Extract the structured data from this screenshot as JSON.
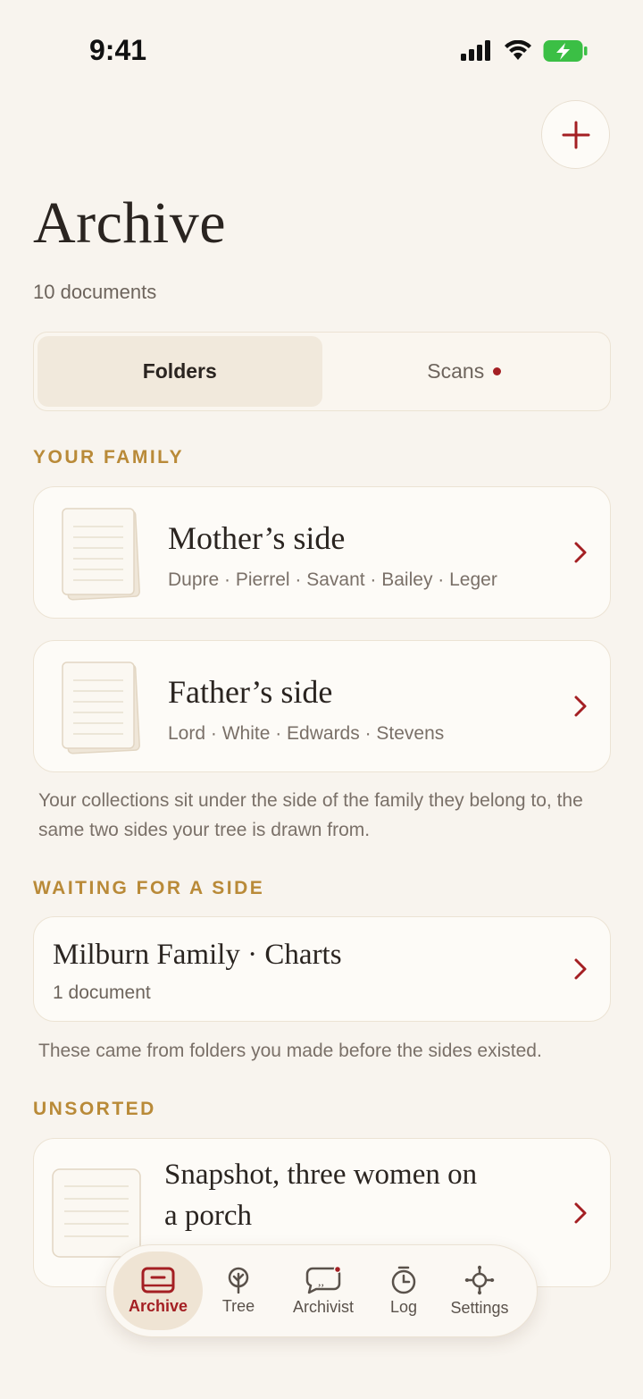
{
  "status": {
    "time": "9:41"
  },
  "header": {
    "title": "Archive",
    "subtitle": "10 documents"
  },
  "segments": {
    "folders": "Folders",
    "scans": "Scans"
  },
  "sections": {
    "family": {
      "label": "YOUR FAMILY",
      "cards": [
        {
          "title": "Mother’s side",
          "subtitle": "Dupre · Pierrel · Savant · Bailey · Leger"
        },
        {
          "title": "Father’s side",
          "subtitle": "Lord · White · Edwards · Stevens"
        }
      ],
      "note": "Your collections sit under the side of the family they belong to, the same two sides your tree is drawn from."
    },
    "waiting": {
      "label": "WAITING FOR A SIDE",
      "card": {
        "title": "Milburn Family · Charts",
        "subtitle": "1 document"
      },
      "note": "These came from folders you made before the sides existed."
    },
    "unsorted": {
      "label": "UNSORTED",
      "card": {
        "title_line1": "Snapshot, three women on",
        "title_line2": "a porch"
      }
    }
  },
  "tabbar": [
    {
      "label": "Archive",
      "icon": "archive-icon",
      "active": true
    },
    {
      "label": "Tree",
      "icon": "tree-icon"
    },
    {
      "label": "Archivist",
      "icon": "chat-icon"
    },
    {
      "label": "Log",
      "icon": "timer-icon"
    },
    {
      "label": "Settings",
      "icon": "gear-icon"
    }
  ],
  "colors": {
    "accent": "#a41f23",
    "gold": "#b98a38",
    "background": "#f8f4ee",
    "card": "#fdfbf7"
  }
}
